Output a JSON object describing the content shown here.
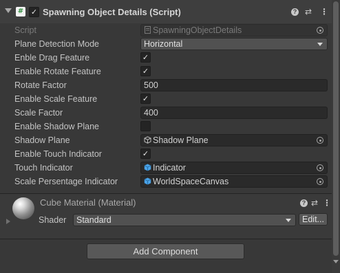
{
  "component": {
    "title": "Spawning Object Details (Script)",
    "script_icon": "#",
    "enabled": true,
    "icons": [
      "help-icon",
      "preset-icon",
      "more-vert-icon"
    ]
  },
  "properties": [
    {
      "label": "Script",
      "type": "object",
      "value": "SpawningObjectDetails",
      "icon": "script-file-icon",
      "dim": true
    },
    {
      "label": "Plane Detection Mode",
      "type": "dropdown",
      "value": "Horizontal"
    },
    {
      "label": "Enble Drag Feature",
      "type": "checkbox",
      "checked": true
    },
    {
      "label": "Enable Rotate Feature",
      "type": "checkbox",
      "checked": true
    },
    {
      "label": "Rotate Factor",
      "type": "number",
      "value": "500"
    },
    {
      "label": "Enable Scale Feature",
      "type": "checkbox",
      "checked": true
    },
    {
      "label": "Scale Factor",
      "type": "number",
      "value": "400"
    },
    {
      "label": "Enable Shadow Plane",
      "type": "checkbox",
      "checked": false
    },
    {
      "label": "Shadow Plane",
      "type": "object",
      "value": "Shadow Plane",
      "icon": "prefab-icon"
    },
    {
      "label": "Enable Touch Indicator",
      "type": "checkbox",
      "checked": true
    },
    {
      "label": "Touch Indicator",
      "type": "object",
      "value": "Indicator",
      "icon": "cube-icon"
    },
    {
      "label": "Scale Persentage Indicator",
      "type": "object",
      "value": "WorldSpaceCanvas",
      "icon": "cube-icon"
    }
  ],
  "material": {
    "title": "Cube Material (Material)",
    "shader_label": "Shader",
    "shader_value": "Standard",
    "edit_label": "Edit..."
  },
  "footer": {
    "add_component_label": "Add Component"
  },
  "checkmark": "✓",
  "colors": {
    "panel_bg": "#383838",
    "header_bg": "#3e3e3e",
    "field_bg": "#2a2a2a",
    "button_bg": "#585858",
    "accent_icon": "#4aa3e8"
  }
}
